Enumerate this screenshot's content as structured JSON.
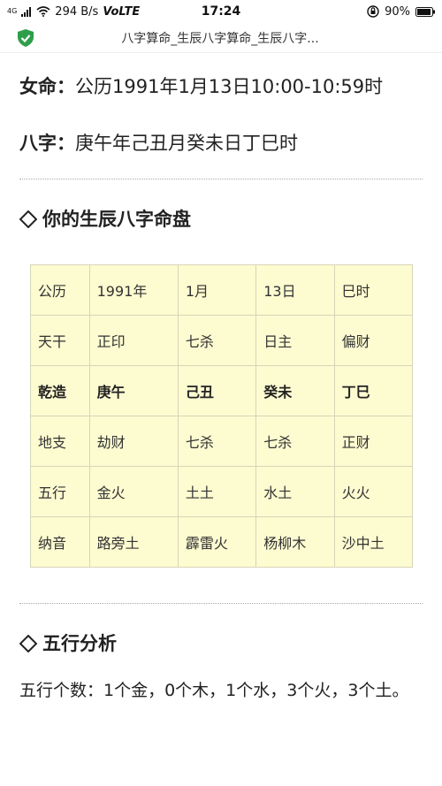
{
  "status": {
    "net_small": "4G",
    "speed": "294 B/s",
    "volte": "VoLTE",
    "time": "17:24",
    "battery": "90%"
  },
  "browser": {
    "title": "八字算命_生辰八字算命_生辰八字..."
  },
  "person": {
    "gender_label": "女命：",
    "birth_text": "公历1991年1月13日10:00-10:59时",
    "bazi_label": "八字：",
    "bazi_text": "庚午年己丑月癸未日丁巳时"
  },
  "chart": {
    "title": "你的生辰八字命盘",
    "rows": [
      [
        "公历",
        "1991年",
        "1月",
        "13日",
        "巳时"
      ],
      [
        "天干",
        "正印",
        "七杀",
        "日主",
        "偏财"
      ],
      [
        "乾造",
        "庚午",
        "己丑",
        "癸未",
        "丁巳"
      ],
      [
        "地支",
        "劫财",
        "七杀",
        "七杀",
        "正财"
      ],
      [
        "五行",
        "金火",
        "土土",
        "水土",
        "火火"
      ],
      [
        "纳音",
        "路旁土",
        "霹雷火",
        "杨柳木",
        "沙中土"
      ]
    ]
  },
  "wuxing": {
    "title": "五行分析",
    "text": "五行个数：1个金，0个木，1个水，3个火，3个土。"
  },
  "colors": {
    "table_bg": "#fdfbd0",
    "shield_green": "#2e9e4a"
  }
}
